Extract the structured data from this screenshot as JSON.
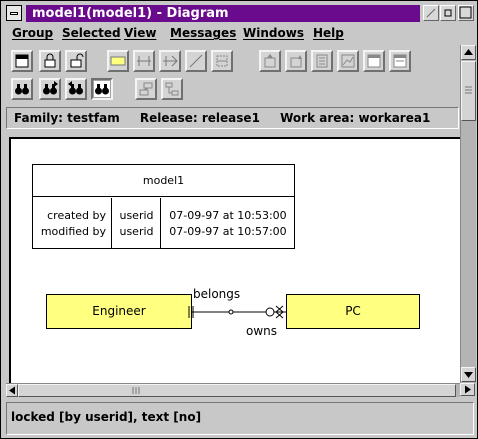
{
  "window": {
    "title": "model1(model1) - Diagram"
  },
  "menubar": {
    "items": [
      "Group",
      "Selected",
      "View",
      "Messages",
      "Windows",
      "Help"
    ]
  },
  "toolbar": {
    "row1_icons": [
      "select-icon",
      "lock-icon",
      "unlock-icon",
      "entity-tool-icon",
      "relationship-tool-icon",
      "one-to-many-icon",
      "delete-line-icon",
      "grid-icon",
      "layout-up-icon",
      "layout-down-icon",
      "table-icon",
      "chart-icon",
      "window-icon",
      "window2-icon"
    ],
    "row2_icons": [
      "find-icon",
      "find-next-icon",
      "find-prev-icon",
      "find-all-icon",
      "zoom-fit-icon",
      "zoom-tree-icon"
    ],
    "active_tool": "find-all-icon"
  },
  "infobar": {
    "family": "Family:  testfam",
    "release": "Release:  release1",
    "workarea": "Work area:  workarea1"
  },
  "diagram": {
    "model": {
      "name": "model1",
      "rows": [
        {
          "label": "created by",
          "user": "userid",
          "when": "07-09-97 at 10:53:00"
        },
        {
          "label": "modified by",
          "user": "userid",
          "when": "07-09-97 at 10:57:00"
        }
      ]
    },
    "entities": {
      "left": "Engineer",
      "right": "PC"
    },
    "relationship": {
      "forward": "belongs",
      "reverse": "owns"
    },
    "entity_fill": "#ffff80"
  },
  "status": {
    "text": "locked [by userid], text [no]"
  },
  "colors": {
    "title_bar": "#6a0a8c",
    "chrome": "#c8c8c8"
  }
}
